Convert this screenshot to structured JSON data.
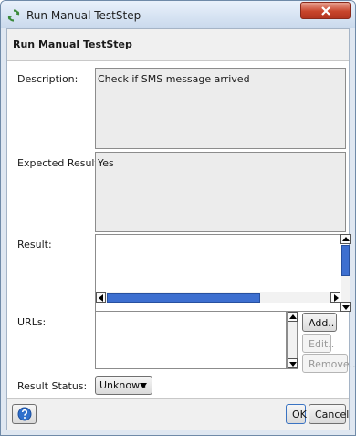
{
  "window": {
    "title": "Run Manual TestStep"
  },
  "header": {
    "title": "Run Manual TestStep"
  },
  "form": {
    "description_label": "Description:",
    "description_value": "Check if SMS message arrived",
    "expected_label": "Expected Result:",
    "expected_value": "Yes",
    "result_label": "Result:",
    "result_value": "",
    "urls_label": "URLs:",
    "add_label": "Add..",
    "edit_label": "Edit..",
    "remove_label": "Remove..",
    "status_label": "Result Status:",
    "status_value": "Unknown"
  },
  "footer": {
    "ok_label": "OK",
    "cancel_label": "Cancel"
  },
  "icons": {
    "app": "refresh-icon",
    "close": "close-icon",
    "help": "help-icon"
  },
  "colors": {
    "accent": "#3d6fd0",
    "close": "#c8452c"
  }
}
